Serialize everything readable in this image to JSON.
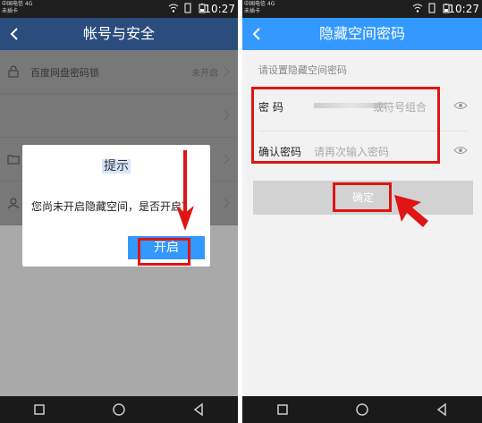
{
  "left_screen": {
    "statusbar": {
      "carrier_line1": "中国电信 4G",
      "carrier_line2": "未插卡",
      "time": "10:27"
    },
    "appbar": {
      "title": "帐号与安全"
    },
    "rows": [
      {
        "label": "百度网盘密码锁",
        "status": "未开启"
      },
      {
        "label": "",
        "status": ""
      },
      {
        "label": "",
        "status": ""
      },
      {
        "label": "",
        "status": ""
      }
    ],
    "dialog": {
      "title": "提示",
      "message": "您尚未开启隐藏空间，是否开启？",
      "confirm_label": "开启"
    }
  },
  "right_screen": {
    "statusbar": {
      "carrier_line1": "中国电信 4G",
      "carrier_line2": "未插卡",
      "time": "10:27"
    },
    "appbar": {
      "title": "隐藏空间密码"
    },
    "hint": "请设置隐藏空间密码",
    "password": {
      "label": "密    码",
      "placeholder": "或符号组合"
    },
    "confirm": {
      "label": "确认密码",
      "placeholder": "请再次输入密码"
    },
    "submit_label": "确定"
  },
  "colors": {
    "left_appbar": "#2b4d7e",
    "right_appbar": "#3399ff",
    "annotation_red": "#e01414",
    "button_blue": "#3399ff",
    "button_disabled": "#d2d2d2"
  }
}
